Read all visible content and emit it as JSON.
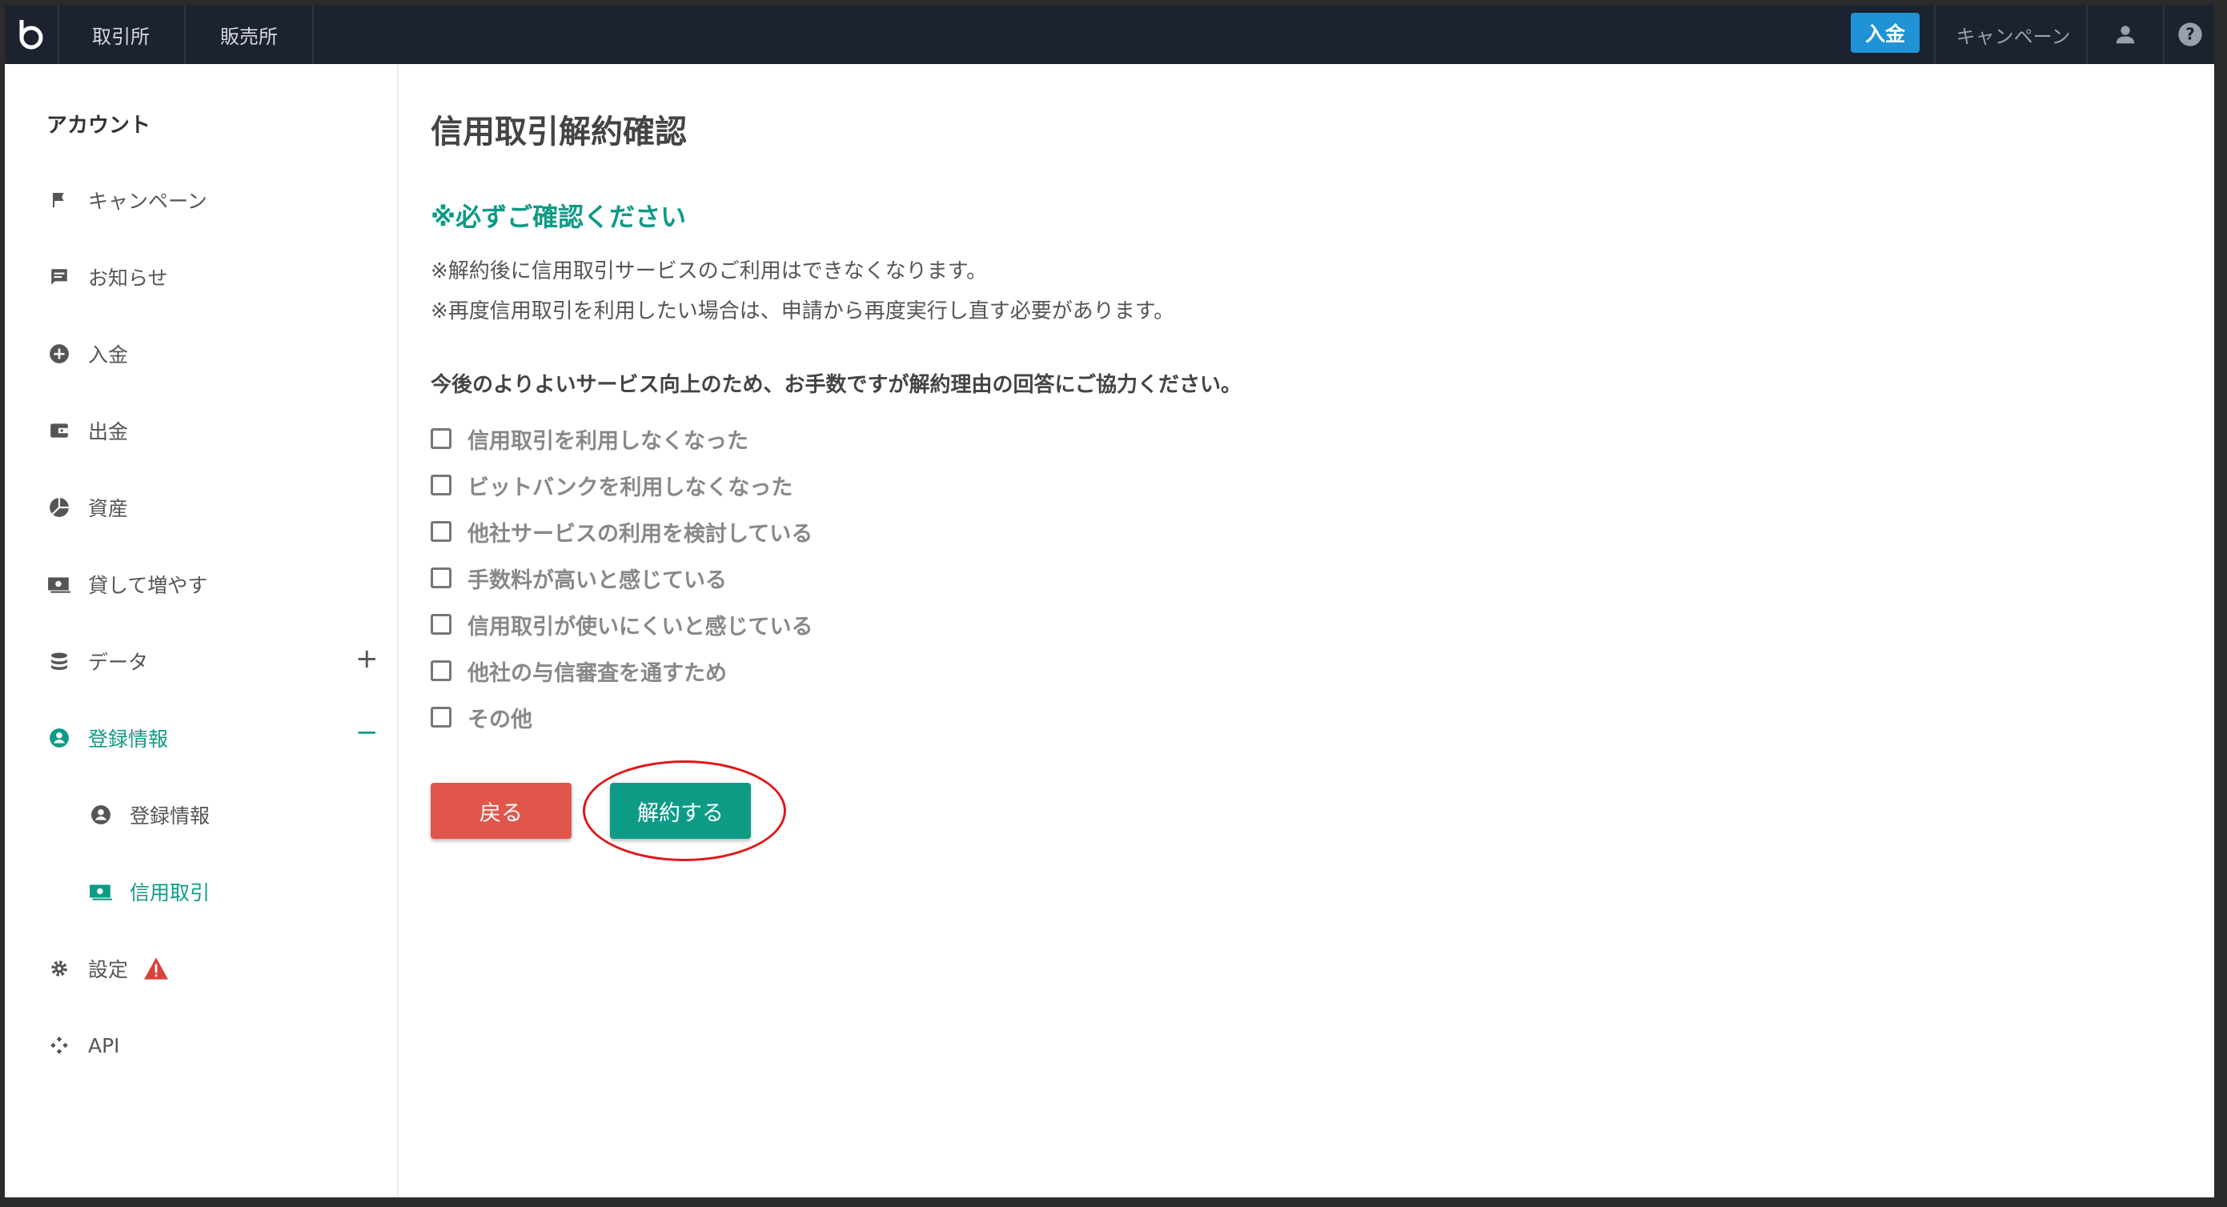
{
  "topbar": {
    "nav_exchange": "取引所",
    "nav_sales": "販売所",
    "deposit_label": "入金",
    "campaign_label": "キャンペーン",
    "icons": [
      "bitbank-logo-icon",
      "user-icon",
      "help-icon"
    ]
  },
  "sidebar": {
    "title": "アカウント",
    "items": [
      {
        "label": "キャンペーン",
        "icon": "flag-icon"
      },
      {
        "label": "お知らせ",
        "icon": "message-icon"
      },
      {
        "label": "入金",
        "icon": "plus-circle-icon"
      },
      {
        "label": "出金",
        "icon": "wallet-icon"
      },
      {
        "label": "資産",
        "icon": "pie-chart-icon"
      },
      {
        "label": "貸して増やす",
        "icon": "cash-icon"
      },
      {
        "label": "データ",
        "icon": "database-icon",
        "toggle": "+"
      },
      {
        "label": "登録情報",
        "icon": "account-circle-icon",
        "toggle": "−",
        "active": true
      },
      {
        "label": "登録情報",
        "icon": "account-circle-icon",
        "sub": true
      },
      {
        "label": "信用取引",
        "icon": "cash-icon",
        "sub": true,
        "active": true
      },
      {
        "label": "設定",
        "icon": "gear-icon",
        "warning": true
      },
      {
        "label": "API",
        "icon": "api-icon"
      }
    ]
  },
  "main": {
    "title": "信用取引解約確認",
    "notice_heading": "※必ずご確認ください",
    "notice_lines": [
      "※解約後に信用取引サービスのご利用はできなくなります。",
      "※再度信用取引を利用したい場合は、申請から再度実行し直す必要があります。"
    ],
    "survey_question": "今後のよりよいサービス向上のため、お手数ですが解約理由の回答にご協力ください。",
    "reasons": [
      "信用取引を利用しなくなった",
      "ビットバンクを利用しなくなった",
      "他社サービスの利用を検討している",
      "手数料が高いと感じている",
      "信用取引が使いにくいと感じている",
      "他社の与信審査を通すため",
      "その他"
    ],
    "back_label": "戻る",
    "cancel_label": "解約する"
  },
  "colors": {
    "topbar_bg": "#1c2230",
    "accent_green": "#0e9b86",
    "deposit_blue": "#1f93d6",
    "back_red": "#e0564b",
    "highlight_red": "#e01818"
  }
}
